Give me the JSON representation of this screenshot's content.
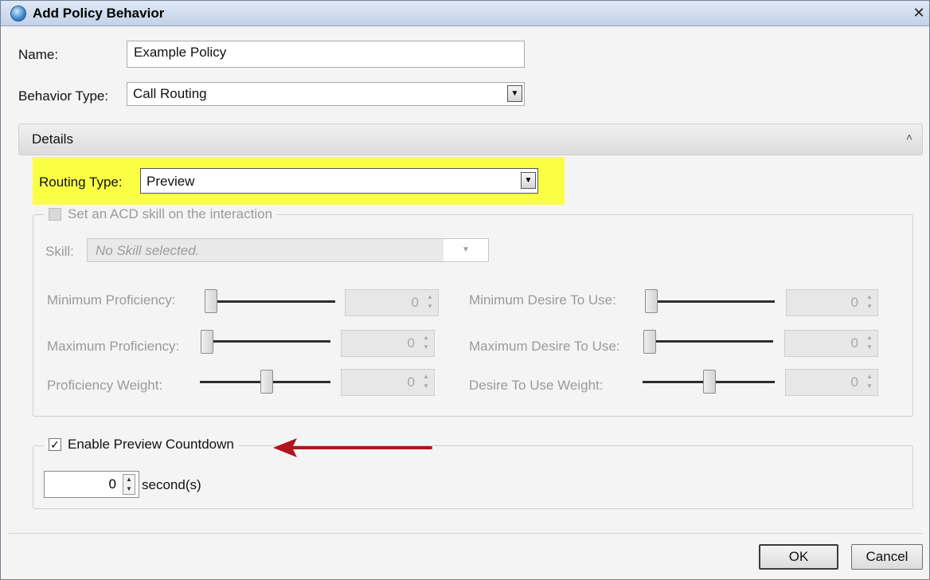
{
  "window": {
    "title": "Add Policy Behavior",
    "close_label": "✕"
  },
  "form": {
    "name_label": "Name:",
    "name_value": "Example Policy",
    "behavior_type_label": "Behavior Type:",
    "behavior_type_value": "Call Routing"
  },
  "details": {
    "header": "Details",
    "routing_type_label": "Routing Type:",
    "routing_type_value": "Preview",
    "acd_skill": {
      "checkbox_label": "Set an ACD skill on the interaction",
      "checked": false,
      "skill_label": "Skill:",
      "skill_placeholder": "No Skill selected.",
      "min_proficiency_label": "Minimum Proficiency:",
      "min_proficiency_value": "0",
      "max_proficiency_label": "Maximum Proficiency:",
      "max_proficiency_value": "0",
      "proficiency_weight_label": "Proficiency Weight:",
      "proficiency_weight_value": "0",
      "min_desire_label": "Minimum Desire To Use:",
      "min_desire_value": "0",
      "max_desire_label": "Maximum Desire To Use:",
      "max_desire_value": "0",
      "desire_weight_label": "Desire To Use Weight:",
      "desire_weight_value": "0"
    },
    "preview_countdown": {
      "checkbox_label": "Enable Preview Countdown",
      "checked": true,
      "seconds_value": "0",
      "seconds_unit": "second(s)"
    }
  },
  "buttons": {
    "ok": "OK",
    "cancel": "Cancel"
  },
  "colors": {
    "highlight": "#fbff44",
    "arrow": "#b0161e",
    "titlebar": "#c3d2e8"
  }
}
